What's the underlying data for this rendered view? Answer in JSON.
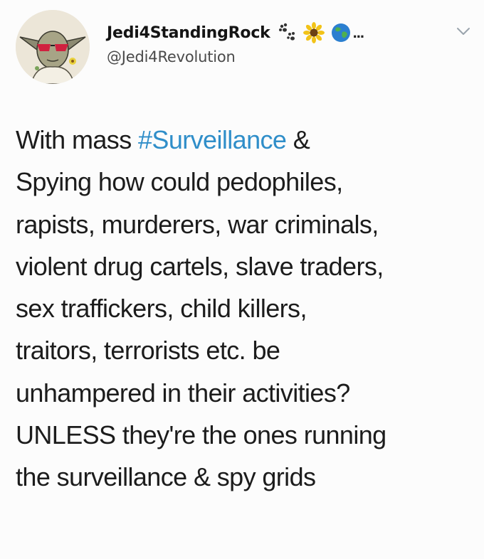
{
  "tweet": {
    "author": {
      "display_name": "Jedi4StandingRock",
      "handle": "@Jedi4Revolution",
      "name_emojis": [
        "paw-prints",
        "sunflower",
        "globe"
      ],
      "name_truncation": "...",
      "avatar_icon": "yoda-avatar-icon"
    },
    "menu_icon": "chevron-down-icon",
    "text": {
      "line1_before": "With mass ",
      "line1_hashtag": "#Surveillance",
      "line1_after": " &",
      "line2": "Spying how could pedophiles,",
      "line3": "rapists, murderers, war criminals,",
      "line4": "violent drug cartels, slave traders,",
      "line5": "sex traffickers, child killers,",
      "line6": "traitors, terrorists etc. be",
      "line7": "unhampered in their activities?",
      "line8": "UNLESS they're the ones running",
      "line9": "the surveillance & spy grids"
    },
    "colors": {
      "hashtag": "#2f8ec9",
      "text": "#1c1c1c",
      "background": "#fcfcfc"
    }
  }
}
